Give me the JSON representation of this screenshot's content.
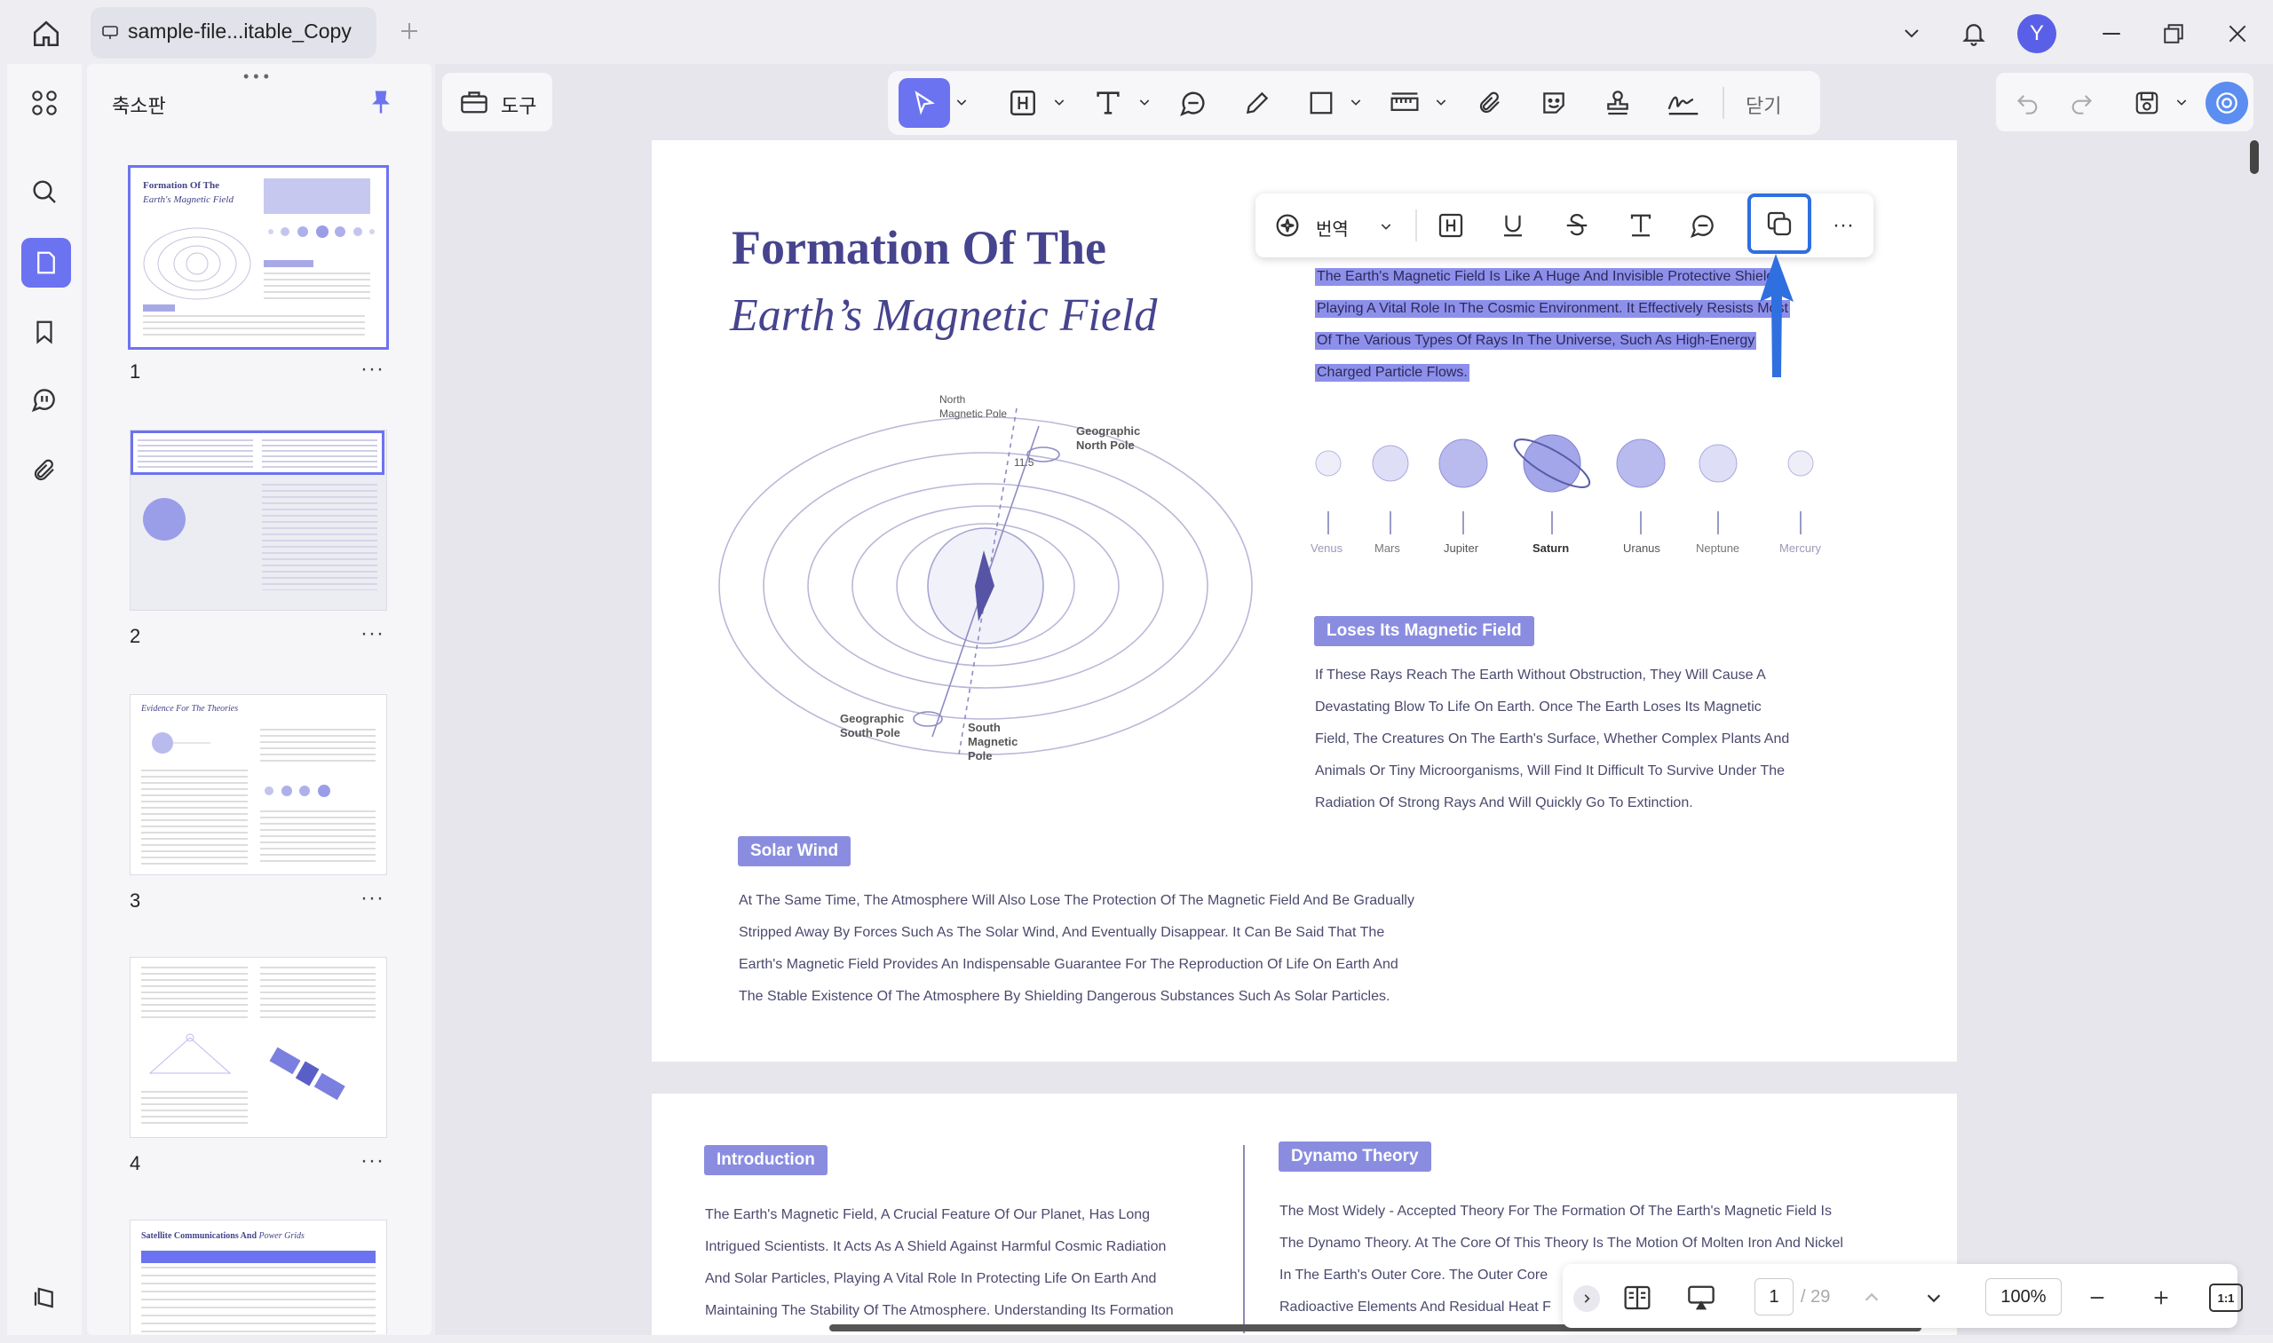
{
  "app": {
    "tab_title": "sample-file...itable_Copy",
    "user_initial": "Y"
  },
  "toolbar": {
    "tools_label": "도구",
    "close_label": "닫기"
  },
  "sidebar": {
    "panel_title": "축소판"
  },
  "thumbnails": [
    {
      "number": "1",
      "title_a": "Formation Of The",
      "title_b": "Earth's Magnetic Field"
    },
    {
      "number": "2"
    },
    {
      "number": "3",
      "title_a": "Evidence For The Theories"
    },
    {
      "number": "4"
    },
    {
      "number": "",
      "title_a": "Satellite Communications And",
      "title_b": "Power Grids"
    }
  ],
  "thumb_more": "···",
  "floating_toolbar": {
    "translate_label": "번역",
    "more_label": "···"
  },
  "page1": {
    "title_line1": "Formation Of The",
    "title_line2": "Earth’s Magnetic Field",
    "selected_lines": [
      "The Earth's Magnetic Field Is Like A Huge And Invisible Protective Shield,",
      "Playing A Vital Role In The Cosmic Environment. It Effectively Resists Most",
      "Of The Various Types Of Rays In The Universe, Such As High-Energy",
      "Charged Particle Flows."
    ],
    "diagram_labels": {
      "north_magnetic_pole": "North\nMagnetic Pole",
      "geographic_north_pole": "Geographic\nNorth Pole",
      "angle": "11.5",
      "geographic_south_pole": "Geographic\nSouth Pole",
      "south_magnetic_pole": "South\nMagnetic\nPole"
    },
    "planets": [
      "Venus",
      "Mars",
      "Jupiter",
      "Saturn",
      "Uranus",
      "Neptune",
      "Mercury"
    ],
    "loses_heading": "Loses Its Magnetic Field",
    "loses_lines": [
      "If These Rays Reach The Earth Without Obstruction, They Will Cause A",
      "Devastating Blow To Life On Earth. Once The Earth Loses Its Magnetic",
      "Field, The Creatures On The Earth's Surface, Whether Complex Plants And",
      "Animals Or Tiny Microorganisms, Will Find It Difficult To Survive Under The",
      "Radiation Of Strong Rays And Will Quickly Go To Extinction."
    ],
    "solar_heading": "Solar Wind",
    "solar_lines": [
      "At The Same Time, The Atmosphere Will Also Lose The Protection Of The Magnetic Field And Be Gradually",
      "Stripped Away By Forces Such As The Solar Wind, And Eventually Disappear. It Can Be Said That The",
      "Earth's Magnetic Field Provides An Indispensable Guarantee For The Reproduction Of Life On Earth And",
      "The Stable Existence Of The Atmosphere By Shielding Dangerous Substances Such As Solar Particles."
    ]
  },
  "page2": {
    "intro_heading": "Introduction",
    "intro_lines": [
      "The Earth's Magnetic Field, A Crucial Feature Of Our Planet, Has Long",
      "Intrigued Scientists. It Acts As A Shield Against Harmful Cosmic Radiation",
      "And Solar Particles, Playing A Vital Role In Protecting Life On Earth And",
      "Maintaining The Stability Of The Atmosphere. Understanding Its Formation"
    ],
    "dynamo_heading": "Dynamo Theory",
    "dynamo_lines": [
      "The Most Widely - Accepted Theory For The Formation Of The Earth's Magnetic Field Is",
      "The Dynamo Theory. At The Core Of This Theory Is The Motion Of Molten Iron And Nickel",
      "In The Earth's Outer Core. The Outer Core",
      "Radioactive Elements And Residual Heat F"
    ]
  },
  "navigation": {
    "current_page": "1",
    "total_pages": "/ 29",
    "zoom": "100%",
    "fit_label": "1:1"
  },
  "colors": {
    "accent": "#6c73f0",
    "highlight_box": "#2f6fe0",
    "selection": "#8d90ea",
    "tag": "#8a8ddf"
  }
}
